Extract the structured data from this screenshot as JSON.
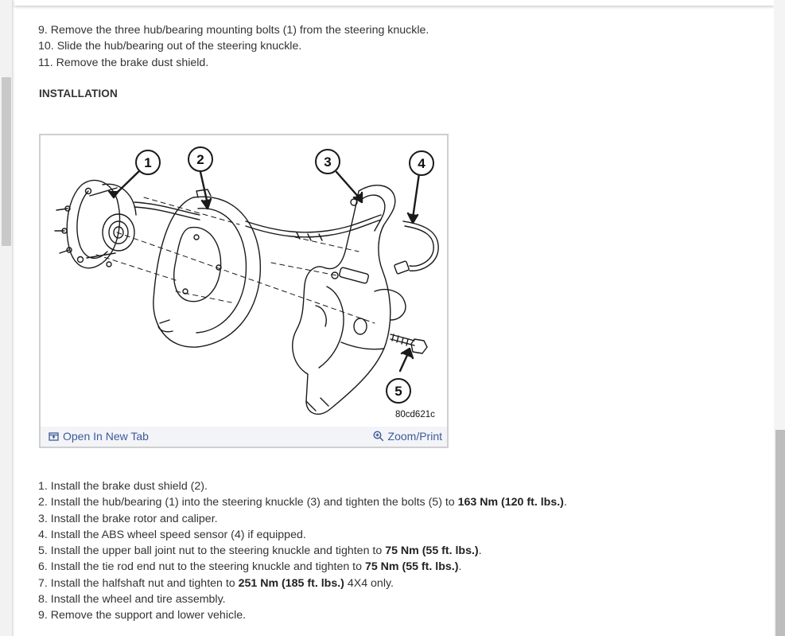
{
  "removal_steps": [
    {
      "num": "9.",
      "text": "Remove the three hub/bearing mounting bolts (1) from the steering knuckle."
    },
    {
      "num": "10.",
      "text": "Slide the hub/bearing out of the steering knuckle."
    },
    {
      "num": "11.",
      "text": "Remove the brake dust shield."
    }
  ],
  "installation_heading": "INSTALLATION",
  "figure": {
    "id": "80cd621c",
    "callouts": [
      "1",
      "2",
      "3",
      "4",
      "5"
    ],
    "open_tab_label": "Open In New Tab",
    "zoom_label": "Zoom/Print"
  },
  "install_steps": [
    {
      "num": "1.",
      "text": "Install the brake dust shield (2).",
      "bold": "",
      "after": ""
    },
    {
      "num": "2.",
      "text": "Install the hub/bearing (1) into the steering knuckle (3) and tighten the bolts (5) to ",
      "bold": "163 Nm (120 ft. lbs.)",
      "after": "."
    },
    {
      "num": "3.",
      "text": "Install the brake rotor and caliper.",
      "bold": "",
      "after": ""
    },
    {
      "num": "4.",
      "text": "Install the ABS wheel speed sensor (4) if equipped.",
      "bold": "",
      "after": ""
    },
    {
      "num": "5.",
      "text": "Install the upper ball joint nut to the steering knuckle and tighten to ",
      "bold": "75 Nm (55 ft. lbs.)",
      "after": "."
    },
    {
      "num": "6.",
      "text": "Install the tie rod end nut to the steering knuckle and tighten to ",
      "bold": "75 Nm (55 ft. lbs.)",
      "after": "."
    },
    {
      "num": "7.",
      "text": "Install the halfshaft nut and tighten to ",
      "bold": "251 Nm (185 ft. lbs.)",
      "after": " 4X4 only."
    },
    {
      "num": "8.",
      "text": "Install the wheel and tire assembly.",
      "bold": "",
      "after": ""
    },
    {
      "num": "9.",
      "text": "Remove the support and lower vehicle.",
      "bold": "",
      "after": ""
    }
  ]
}
